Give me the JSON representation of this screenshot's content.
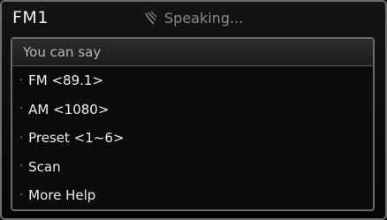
{
  "header": {
    "title": "FM1",
    "status": "Speaking...",
    "status_icon": "microphone-speaking-icon"
  },
  "panel": {
    "title": "You can say",
    "bullet": "·",
    "items": [
      {
        "label": "FM <89.1>"
      },
      {
        "label": "AM <1080>"
      },
      {
        "label": "Preset <1~6>"
      },
      {
        "label": "Scan"
      },
      {
        "label": "More Help"
      }
    ]
  }
}
